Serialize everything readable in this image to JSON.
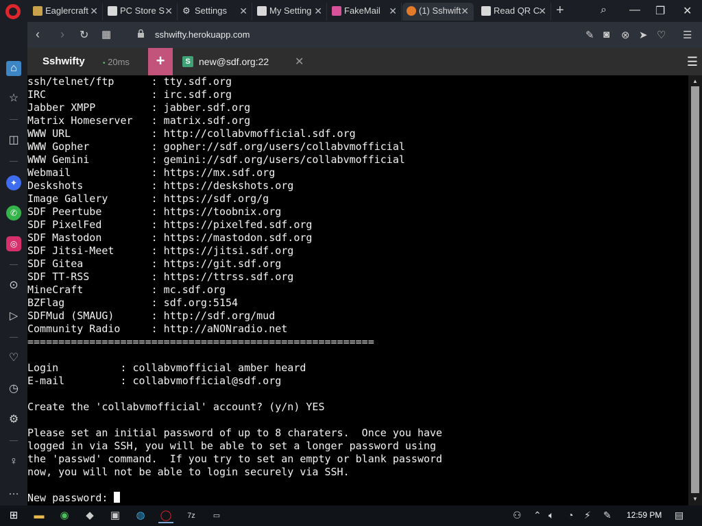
{
  "browser": {
    "tabs": [
      {
        "label": "Eaglercraft",
        "favicon_color": "#c8a24a"
      },
      {
        "label": "PC Store S",
        "favicon_color": "#d8d8d8"
      },
      {
        "label": "Settings",
        "favicon_color": "#d8d8d8"
      },
      {
        "label": "My Setting",
        "favicon_color": "#d8d8d8"
      },
      {
        "label": "FakeMail",
        "favicon_color": "#d7529b"
      },
      {
        "label": "(1) Sshwift",
        "favicon_color": "#e27a2a"
      },
      {
        "label": "Read QR C",
        "favicon_color": "#d8d8d8"
      }
    ],
    "active_tab_index": 5,
    "url": "sshwifty.herokuapp.com"
  },
  "app": {
    "title": "Sshwifty",
    "latency": "20ms",
    "add_label": "+",
    "connection": {
      "badge": "S",
      "name": "new@sdf.org:22"
    },
    "accent": "#c2547c"
  },
  "terminal": {
    "lines": [
      "ssh/telnet/ftp      : tty.sdf.org",
      "IRC                 : irc.sdf.org",
      "Jabber XMPP         : jabber.sdf.org",
      "Matrix Homeserver   : matrix.sdf.org",
      "WWW URL             : http://collabvmofficial.sdf.org",
      "WWW Gopher          : gopher://sdf.org/users/collabvmofficial",
      "WWW Gemini          : gemini://sdf.org/users/collabvmofficial",
      "Webmail             : https://mx.sdf.org",
      "Deskshots           : https://deskshots.org",
      "Image Gallery       : https://sdf.org/g",
      "SDF Peertube        : https://toobnix.org",
      "SDF PixelFed        : https://pixelfed.sdf.org",
      "SDF Mastodon        : https://mastodon.sdf.org",
      "SDF Jitsi-Meet      : https://jitsi.sdf.org",
      "SDF Gitea           : https://git.sdf.org",
      "SDF TT-RSS          : https://ttrss.sdf.org",
      "MineCraft           : mc.sdf.org",
      "BZFlag              : sdf.org:5154",
      "SDFMud (SMAUG)      : http://sdf.org/mud",
      "Community Radio     : http://aNONradio.net",
      "========================================================",
      "",
      "Login          : collabvmofficial amber heard",
      "E-mail         : collabvmofficial@sdf.org",
      "",
      "Create the 'collabvmofficial' account? (y/n) YES",
      "",
      "Please set an initial password of up to 8 charaters.  Once you have",
      "logged in via SSH, you will be able to set a longer password using",
      "the 'passwd' command.  If you try to set an empty or blank password",
      "now, you will not be able to login securely via SSH.",
      ""
    ],
    "prompt": "New password: "
  },
  "taskbar": {
    "clock": "12:59 PM"
  }
}
